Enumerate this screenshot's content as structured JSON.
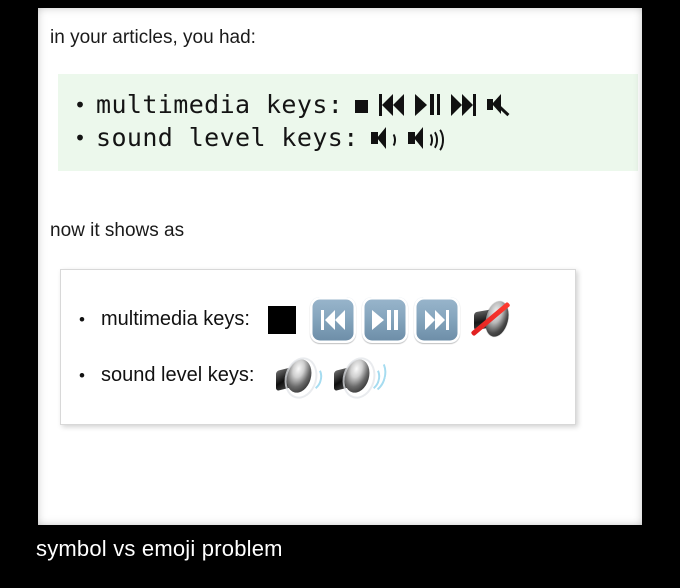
{
  "slide": {
    "caption": "symbol vs emoji problem",
    "background_color": "#000000",
    "caption_color": "#ffffff"
  },
  "screenshot": {
    "background_color": "#ffffff",
    "lead_text": "in your articles, you had:",
    "transition_text": "now it shows as",
    "code_block": {
      "background_color": "#ecf8ec",
      "text_color": "#141414",
      "items": [
        {
          "bullet": "•",
          "label": "multimedia keys:",
          "symbols": [
            {
              "name": "stop-symbol",
              "char": "■"
            },
            {
              "name": "rewind-symbol",
              "char": "⏮"
            },
            {
              "name": "play-pause-symbol",
              "char": "⏯"
            },
            {
              "name": "fast-forward-symbol",
              "char": "⏭"
            },
            {
              "name": "mute-symbol",
              "char": "🔇"
            }
          ]
        },
        {
          "bullet": "•",
          "label": "sound level keys:",
          "symbols": [
            {
              "name": "speaker-low-volume-symbol",
              "char": "🔉"
            },
            {
              "name": "speaker-high-volume-symbol",
              "char": "🔊"
            }
          ]
        }
      ]
    },
    "emoji_card": {
      "background_color": "#ffffff",
      "border_color": "#d8d8d8",
      "button_color": "#87a7bf",
      "slash_color": "#ff3b30",
      "wave_color": "#a6dcf0",
      "items": [
        {
          "bullet": "•",
          "label": "multimedia keys:",
          "emoji": [
            {
              "name": "stop-emoji"
            },
            {
              "name": "rewind-emoji"
            },
            {
              "name": "play-pause-emoji"
            },
            {
              "name": "fast-forward-emoji"
            },
            {
              "name": "muted-speaker-emoji"
            }
          ]
        },
        {
          "bullet": "•",
          "label": "sound level keys:",
          "emoji": [
            {
              "name": "speaker-low-volume-emoji"
            },
            {
              "name": "speaker-high-volume-emoji"
            }
          ]
        }
      ]
    }
  }
}
